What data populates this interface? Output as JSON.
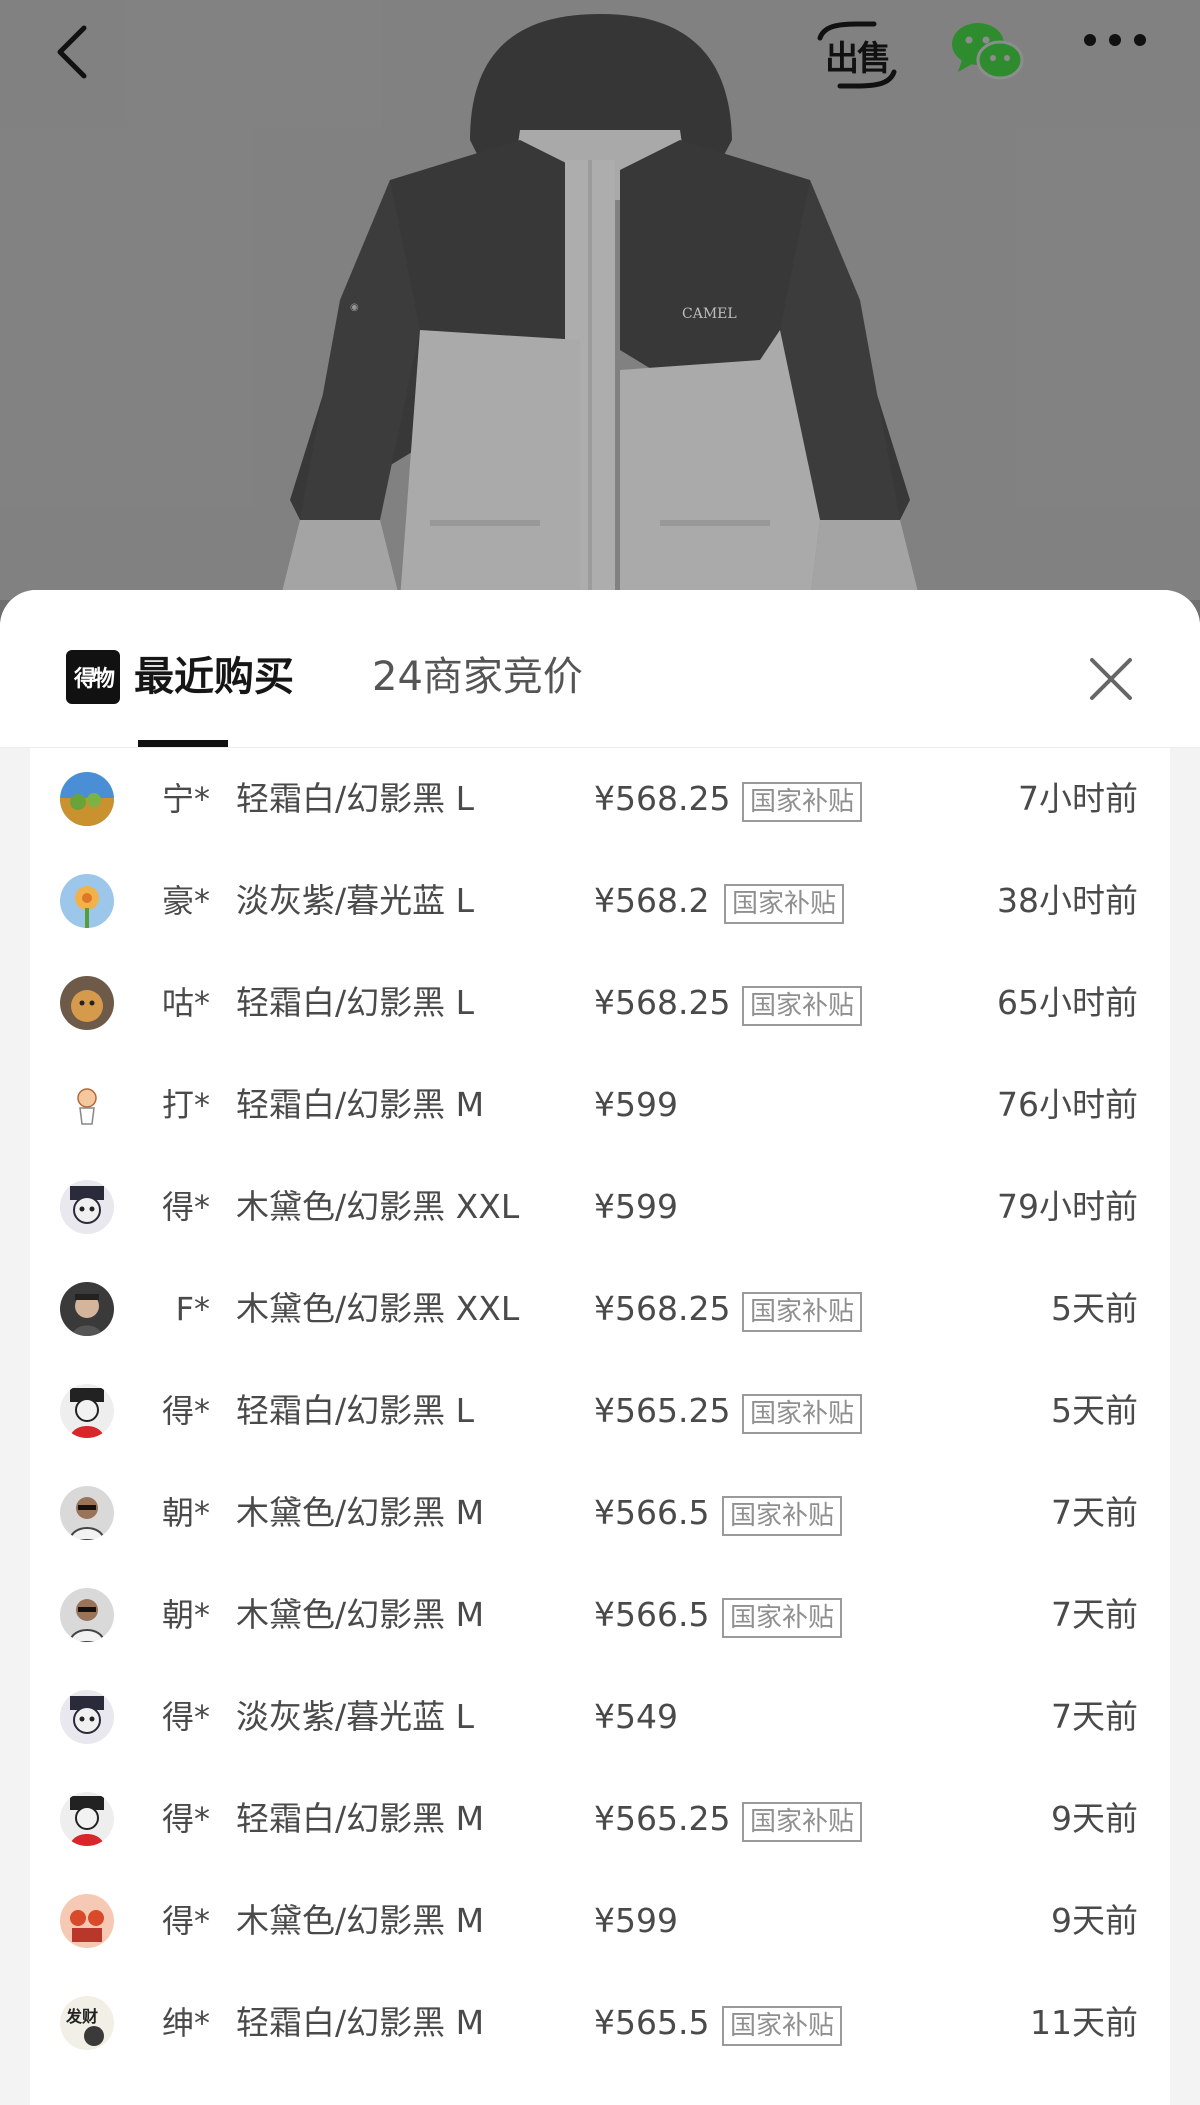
{
  "top_bar": {
    "sell_label": "出售"
  },
  "product": {
    "brand_on_jacket": "CAMEL"
  },
  "sheet": {
    "logo_text": "得物",
    "tabs": [
      {
        "label": "最近购买",
        "active": true
      },
      {
        "label": "24商家竞价",
        "active": false
      }
    ]
  },
  "colors": {
    "accent": "#111111",
    "badge_border": "#9a9a9a",
    "text": "#4a4a4a"
  },
  "purchases": [
    {
      "buyer": "宁*",
      "sku": "轻霜白/幻影黑 L",
      "price": "¥568.25",
      "badge": "国家补贴",
      "time": "7小时前",
      "avatar": "landscape"
    },
    {
      "buyer": "豪*",
      "sku": "淡灰紫/暮光蓝 L",
      "price": "¥568.2",
      "badge": "国家补贴",
      "time": "38小时前",
      "avatar": "flower"
    },
    {
      "buyer": "咕*",
      "sku": "轻霜白/幻影黑 L",
      "price": "¥568.25",
      "badge": "国家补贴",
      "time": "65小时前",
      "avatar": "dog"
    },
    {
      "buyer": "打*",
      "sku": "轻霜白/幻影黑 M",
      "price": "¥599",
      "badge": "",
      "time": "76小时前",
      "avatar": "doodle"
    },
    {
      "buyer": "得*",
      "sku": "木黛色/幻影黑 XXL",
      "price": "¥599",
      "badge": "",
      "time": "79小时前",
      "avatar": "mascot"
    },
    {
      "buyer": "F*",
      "sku": "木黛色/幻影黑 XXL",
      "price": "¥568.25",
      "badge": "国家补贴",
      "time": "5天前",
      "avatar": "portrait"
    },
    {
      "buyer": "得*",
      "sku": "轻霜白/幻影黑 L",
      "price": "¥565.25",
      "badge": "国家补贴",
      "time": "5天前",
      "avatar": "mascot-red"
    },
    {
      "buyer": "朝*",
      "sku": "木黛色/幻影黑 M",
      "price": "¥566.5",
      "badge": "国家补贴",
      "time": "7天前",
      "avatar": "man"
    },
    {
      "buyer": "朝*",
      "sku": "木黛色/幻影黑 M",
      "price": "¥566.5",
      "badge": "国家补贴",
      "time": "7天前",
      "avatar": "man"
    },
    {
      "buyer": "得*",
      "sku": "淡灰紫/暮光蓝 L",
      "price": "¥549",
      "badge": "",
      "time": "7天前",
      "avatar": "mascot"
    },
    {
      "buyer": "得*",
      "sku": "轻霜白/幻影黑 M",
      "price": "¥565.25",
      "badge": "国家补贴",
      "time": "9天前",
      "avatar": "mascot-red"
    },
    {
      "buyer": "得*",
      "sku": "木黛色/幻影黑 M",
      "price": "¥599",
      "badge": "",
      "time": "9天前",
      "avatar": "cartoon"
    },
    {
      "buyer": "绅*",
      "sku": "轻霜白/幻影黑 M",
      "price": "¥565.5",
      "badge": "国家补贴",
      "time": "11天前",
      "avatar": "fortune"
    }
  ]
}
